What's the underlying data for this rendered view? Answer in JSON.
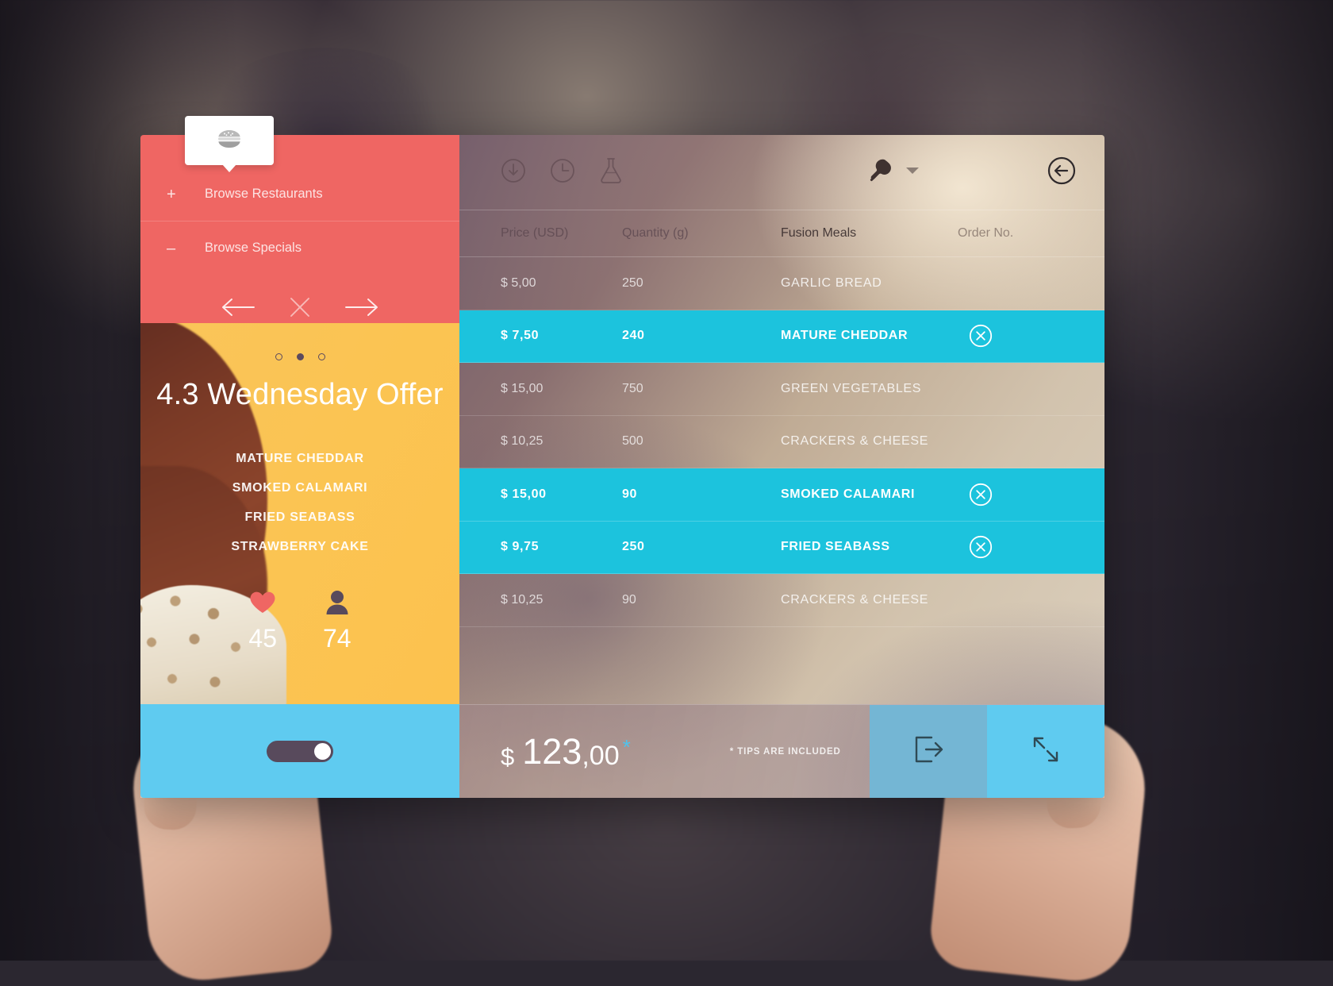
{
  "app": {
    "tooltip_icon": "burger-icon"
  },
  "sidebar": {
    "browse": [
      {
        "sign": "+",
        "label": "Browse Restaurants",
        "icon": "plus-icon"
      },
      {
        "sign": "–",
        "label": "Browse Specials",
        "icon": "minus-icon"
      }
    ],
    "nav": {
      "prev_icon": "arrow-left-icon",
      "close_icon": "close-x-icon",
      "next_icon": "arrow-right-icon"
    }
  },
  "offer": {
    "dots": [
      false,
      true,
      false
    ],
    "title": "4.3 Wednesday Offer",
    "items": [
      "MATURE CHEDDAR",
      "SMOKED CALAMARI",
      "FRIED SEABASS",
      "STRAWBERRY CAKE"
    ],
    "stats": [
      {
        "icon": "heart-icon",
        "value": "45",
        "color": "#ef6663"
      },
      {
        "icon": "person-icon",
        "value": "74",
        "color": "#584a5c"
      }
    ]
  },
  "toggle": {
    "name": "settings-toggle",
    "state": "on"
  },
  "toolbar": {
    "icons": [
      {
        "name": "download-circle-icon"
      },
      {
        "name": "clock-circle-icon"
      },
      {
        "name": "flask-icon"
      }
    ],
    "filter": {
      "icon": "chicken-leg-icon",
      "caret": "chevron-down-icon"
    },
    "back": {
      "icon": "back-arrow-circle-icon"
    }
  },
  "table": {
    "columns": [
      "Price (USD)",
      "Quantity (g)",
      "Fusion Meals",
      "Order No."
    ],
    "rows": [
      {
        "price": "$ 5,00",
        "quantity": "250",
        "meal": "GARLIC BREAD",
        "selected": false
      },
      {
        "price": "$ 7,50",
        "quantity": "240",
        "meal": "MATURE CHEDDAR",
        "selected": true
      },
      {
        "price": "$ 15,00",
        "quantity": "750",
        "meal": "GREEN VEGETABLES",
        "selected": false
      },
      {
        "price": "$ 10,25",
        "quantity": "500",
        "meal": "CRACKERS &  CHEESE",
        "selected": false
      },
      {
        "price": "$ 15,00",
        "quantity": "90",
        "meal": "SMOKED CALAMARI",
        "selected": true
      },
      {
        "price": "$ 9,75",
        "quantity": "250",
        "meal": "FRIED SEABASS",
        "selected": true
      },
      {
        "price": "$ 10,25",
        "quantity": "90",
        "meal": "CRACKERS &  CHEESE",
        "selected": false
      }
    ],
    "delete_icon": "remove-circle-x-icon"
  },
  "total": {
    "currency": "$",
    "integer": "123",
    "decimal": ",00",
    "asterisk": "*",
    "note": "* TIPS ARE INCLUDED",
    "actions": [
      {
        "name": "checkout-button",
        "icon": "exit-arrow-icon"
      },
      {
        "name": "expand-button",
        "icon": "expand-diagonal-icon"
      }
    ]
  },
  "colors": {
    "red": "#ef6663",
    "orange": "#fbc453",
    "cyan": "#1cc3dd",
    "light_blue": "#5fcbf0",
    "muted_blue": "#74b6d4",
    "dark_purple": "#584a5c"
  }
}
